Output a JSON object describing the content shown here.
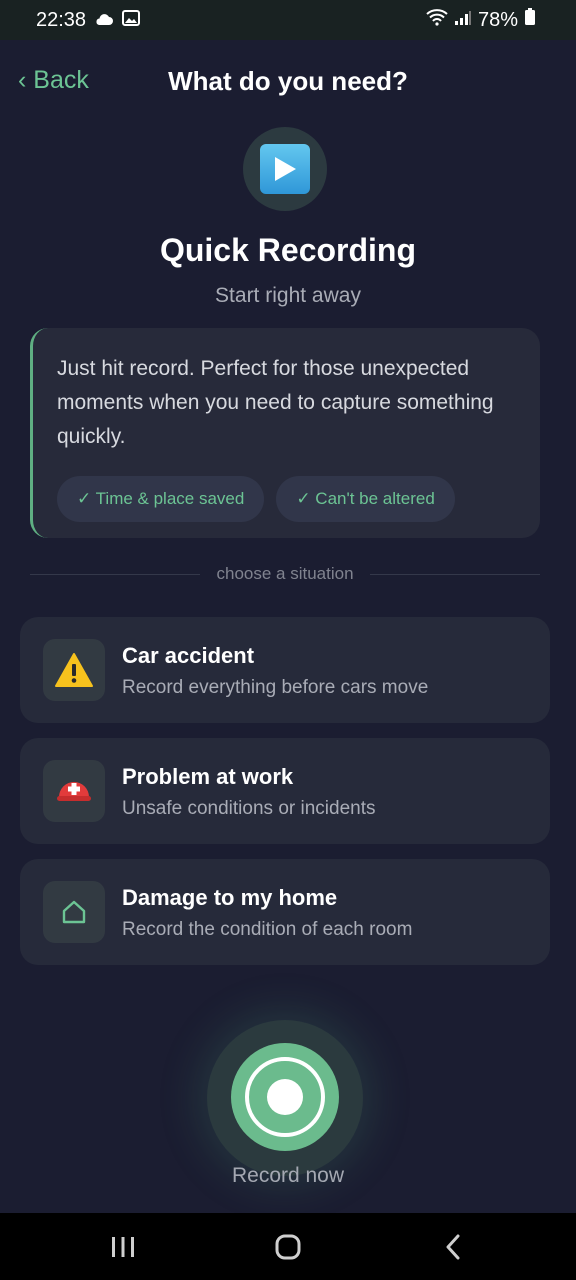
{
  "status": {
    "time": "22:38",
    "battery": "78%"
  },
  "header": {
    "back_label": "‹ Back",
    "title": "What do you need?"
  },
  "hero": {
    "title": "Quick Recording",
    "subtitle": "Start right away"
  },
  "info": {
    "text": "Just hit record. Perfect for those unexpected moments when you need to capture something quickly.",
    "badges": [
      "✓ Time & place saved",
      "✓ Can't be altered"
    ]
  },
  "divider_label": "choose a situation",
  "situations": [
    {
      "title": "Car accident",
      "description": "Record everything before cars move",
      "icon": "warning-icon"
    },
    {
      "title": "Problem at work",
      "description": "Unsafe conditions or incidents",
      "icon": "hard-hat-icon"
    },
    {
      "title": "Damage to my home",
      "description": "Record the condition of each room",
      "icon": "home-icon"
    }
  ],
  "record": {
    "label": "Record now"
  },
  "colors": {
    "accent": "#6cc494",
    "background": "#1b1d31",
    "card": "#262a3a"
  }
}
